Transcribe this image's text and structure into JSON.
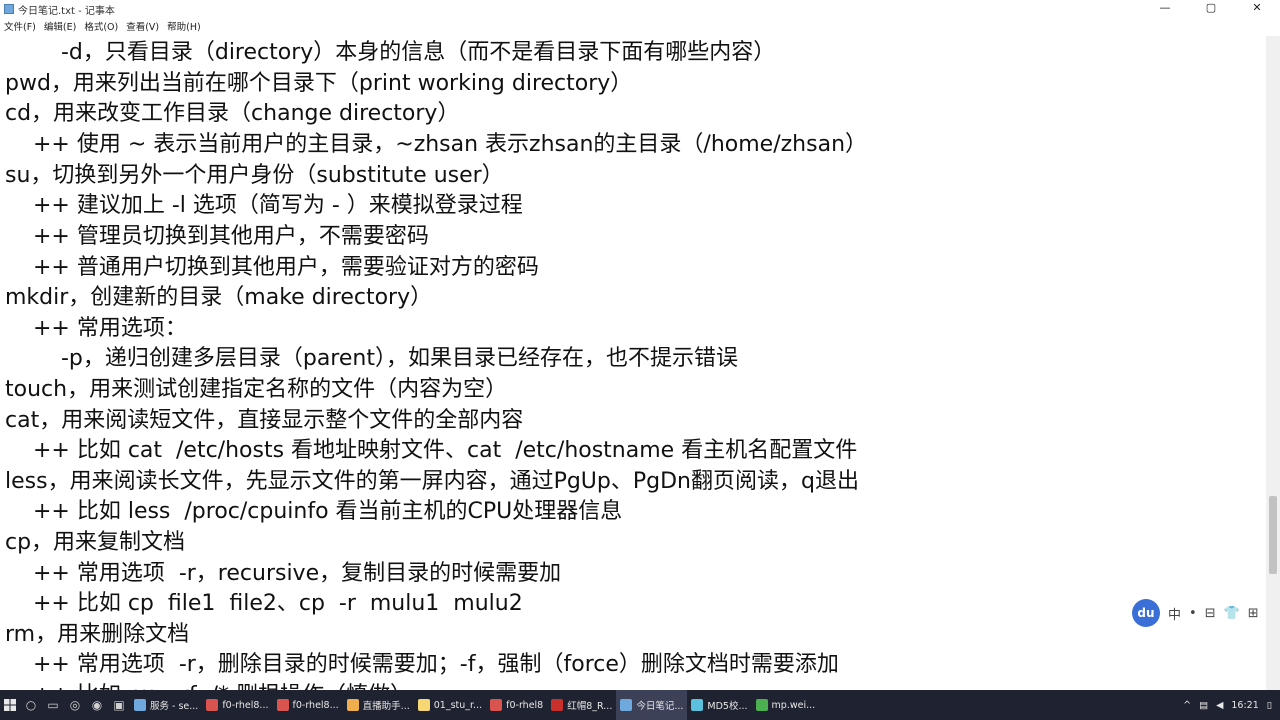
{
  "window": {
    "title": "今日笔记.txt - 记事本",
    "minimize": "—",
    "maximize": "▢",
    "close": "✕"
  },
  "menu": [
    "文件(F)",
    "编辑(E)",
    "格式(O)",
    "查看(V)",
    "帮助(H)"
  ],
  "lines": [
    "        -d，只看目录（directory）本身的信息（而不是看目录下面有哪些内容）",
    "pwd，用来列出当前在哪个目录下（print working directory）",
    "cd，用来改变工作目录（change directory）",
    "    ++ 使用 ~ 表示当前用户的主目录，~zhsan 表示zhsan的主目录（/home/zhsan）",
    "su，切换到另外一个用户身份（substitute user）",
    "    ++ 建议加上 -l 选项（简写为 - ）来模拟登录过程",
    "    ++ 管理员切换到其他用户，不需要密码",
    "    ++ 普通用户切换到其他用户，需要验证对方的密码",
    "mkdir，创建新的目录（make directory）",
    "    ++ 常用选项：",
    "        -p，递归创建多层目录（parent），如果目录已经存在，也不提示错误",
    "touch，用来测试创建指定名称的文件（内容为空）",
    "cat，用来阅读短文件，直接显示整个文件的全部内容",
    "    ++ 比如 cat  /etc/hosts 看地址映射文件、cat  /etc/hostname 看主机名配置文件",
    "less，用来阅读长文件，先显示文件的第一屏内容，通过PgUp、PgDn翻页阅读，q退出",
    "    ++ 比如 less  /proc/cpuinfo 看当前主机的CPU处理器信息",
    "cp，用来复制文档",
    "    ++ 常用选项  -r，recursive，复制目录的时候需要加",
    "    ++ 比如 cp  file1  file2、cp  -r  mulu1  mulu2",
    "rm，用来删除文档",
    "    ++ 常用选项  -r，删除目录的时候需要加；-f，强制（force）删除文档时需要添加",
    "    ++ 比如 rm  -rf  /* 删根操作（慎做）"
  ],
  "ime": {
    "logo": "du",
    "lang": "中",
    "punct": "•",
    "icons": [
      "⊟",
      "👕",
      "⊞"
    ]
  },
  "taskbar": {
    "tasks": [
      {
        "label": "服务 - se...",
        "color": "#6fa8dc"
      },
      {
        "label": "f0-rhel8...",
        "color": "#d9534f"
      },
      {
        "label": "f0-rhel8...",
        "color": "#d9534f"
      },
      {
        "label": "直播助手...",
        "color": "#f0ad4e"
      },
      {
        "label": "01_stu_r...",
        "color": "#f7d774"
      },
      {
        "label": "f0-rhel8",
        "color": "#d9534f"
      },
      {
        "label": "红帽8_R...",
        "color": "#c9302c"
      },
      {
        "label": "今日笔记...",
        "color": "#6fa8dc"
      },
      {
        "label": "MD5校...",
        "color": "#5bc0de"
      },
      {
        "label": "mp.wei...",
        "color": "#4caf50"
      }
    ],
    "active_index": 7,
    "clock": "16:21"
  }
}
